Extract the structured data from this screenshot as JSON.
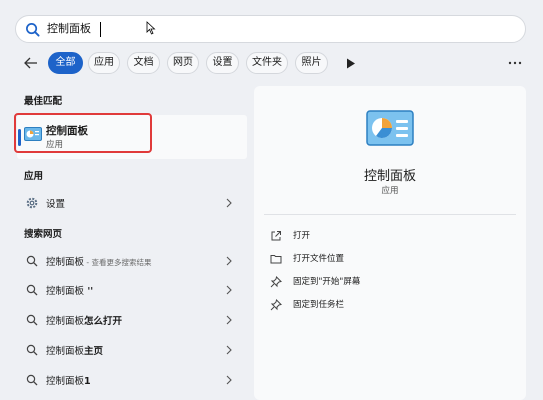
{
  "search": {
    "query": "控制面板"
  },
  "filters": [
    "全部",
    "应用",
    "文档",
    "网页",
    "设置",
    "文件夹",
    "照片"
  ],
  "best_match": {
    "title": "最佳匹配",
    "name": "控制面板",
    "type": "应用"
  },
  "apps": {
    "title": "应用",
    "items": [
      {
        "label": "设置"
      }
    ]
  },
  "web": {
    "title": "搜索网页",
    "items": [
      {
        "main": "控制面板",
        "bold": "",
        "sub": " - 查看更多搜索结果"
      },
      {
        "main": "控制面板",
        "bold": " ''",
        "sub": ""
      },
      {
        "main": "控制面板",
        "bold": "怎么打开",
        "sub": ""
      },
      {
        "main": "控制面板",
        "bold": "主页",
        "sub": ""
      },
      {
        "main": "控制面板",
        "bold": "1",
        "sub": ""
      }
    ]
  },
  "details": {
    "name": "控制面板",
    "type": "应用",
    "actions": [
      {
        "icon": "open-icon",
        "label": "打开"
      },
      {
        "icon": "folder-icon",
        "label": "打开文件位置"
      },
      {
        "icon": "pin-icon",
        "label": "固定到\"开始\"屏幕"
      },
      {
        "icon": "pin-icon",
        "label": "固定到任务栏"
      }
    ]
  },
  "colors": {
    "accent": "#1d63c9",
    "highlight": "#e03a3a",
    "background": "#eef0f4"
  }
}
